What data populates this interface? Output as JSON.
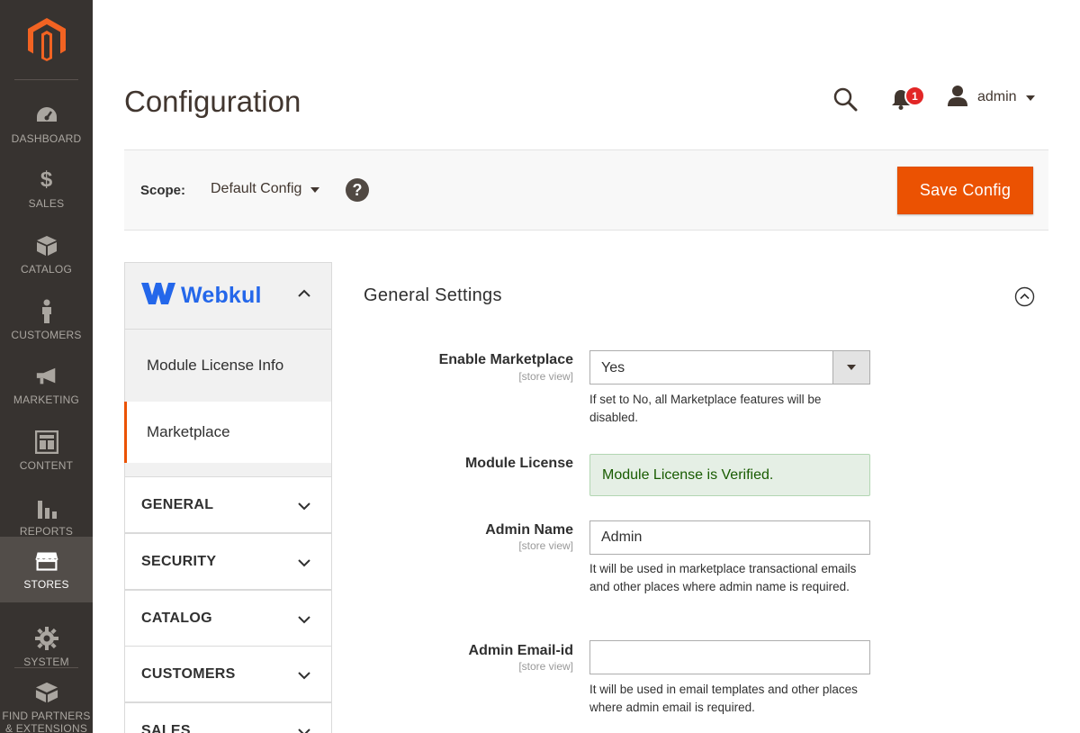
{
  "nav": {
    "items": [
      {
        "label": "DASHBOARD",
        "icon": "dashboard-icon"
      },
      {
        "label": "SALES",
        "icon": "dollar-icon"
      },
      {
        "label": "CATALOG",
        "icon": "box-icon"
      },
      {
        "label": "CUSTOMERS",
        "icon": "person-icon"
      },
      {
        "label": "MARKETING",
        "icon": "megaphone-icon"
      },
      {
        "label": "CONTENT",
        "icon": "layout-icon"
      },
      {
        "label": "REPORTS",
        "icon": "bar-chart-icon"
      },
      {
        "label": "STORES",
        "icon": "store-icon",
        "active": true
      },
      {
        "label": "SYSTEM",
        "icon": "gear-icon"
      },
      {
        "label": "FIND PARTNERS",
        "label2": "& EXTENSIONS",
        "icon": "extensions-icon"
      }
    ]
  },
  "header": {
    "title": "Configuration",
    "notification_count": "1",
    "user_name": "admin"
  },
  "scope": {
    "label": "Scope:",
    "value": "Default Config",
    "help": "?",
    "save_label": "Save Config"
  },
  "tabs": {
    "brand": "Webkul",
    "sub_items": [
      "Module License Info",
      "Marketplace"
    ],
    "groups": [
      "GENERAL",
      "SECURITY",
      "CATALOG",
      "CUSTOMERS",
      "SALES"
    ]
  },
  "section": {
    "title": "General Settings",
    "fields": {
      "enable_marketplace": {
        "label": "Enable Marketplace",
        "scope": "[store view]",
        "value": "Yes",
        "note": "If set to No, all Marketplace features will be disabled."
      },
      "module_license": {
        "label": "Module License",
        "status": "Module License is Verified."
      },
      "admin_name": {
        "label": "Admin Name",
        "scope": "[store view]",
        "value": "Admin",
        "note": "It will be used in marketplace transactional emails and other places where admin name is required."
      },
      "admin_email": {
        "label": "Admin Email-id",
        "scope": "[store view]",
        "value": "",
        "note": "It will be used in email templates and other places where admin email is required."
      }
    }
  },
  "colors": {
    "nav_bg": "#373330",
    "accent": "#eb5202",
    "brand_blue": "#2467ea",
    "badge_red": "#e22626",
    "success_bg": "#e5efe5",
    "success_text": "#185b00"
  }
}
